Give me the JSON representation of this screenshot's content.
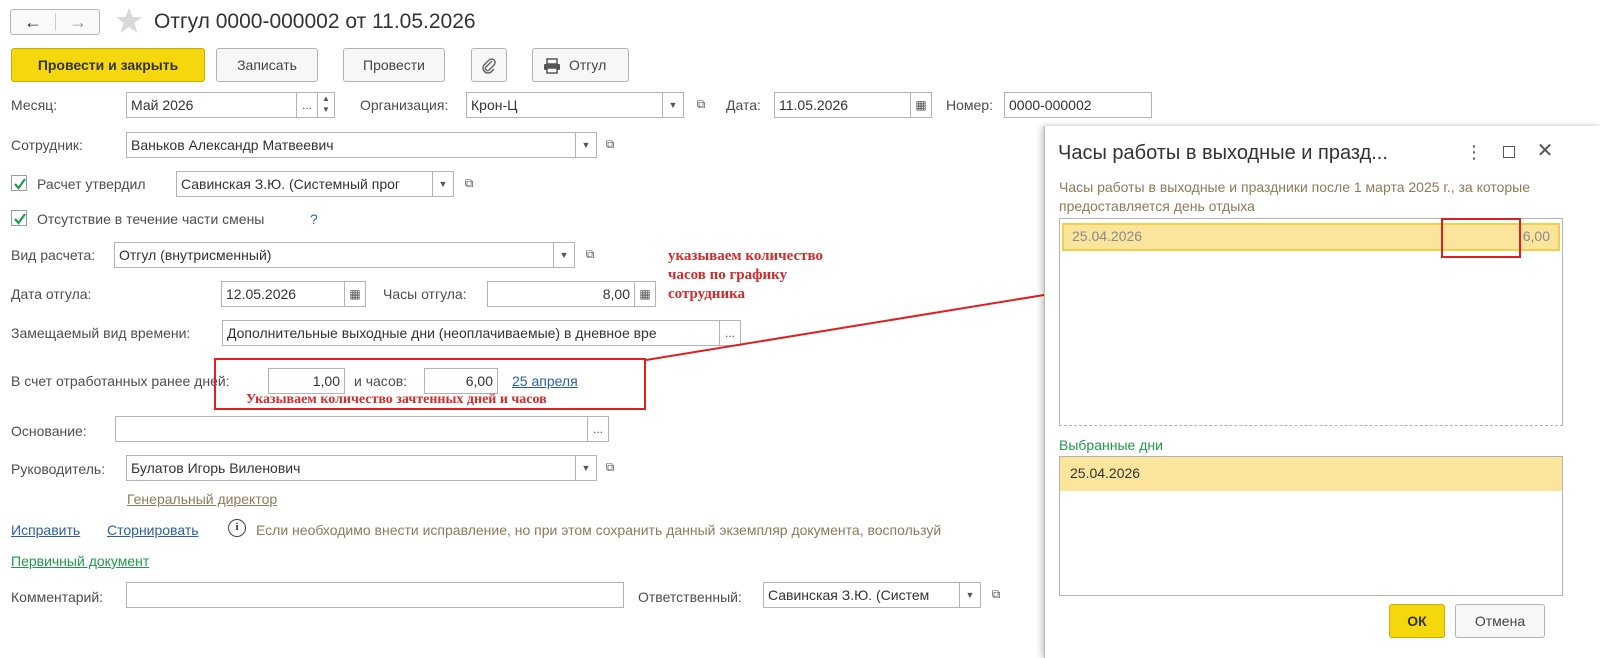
{
  "window": {
    "title": "Отгул 0000-000002 от 11.05.2026"
  },
  "toolbar": {
    "post_close": "Провести и закрыть",
    "save": "Записать",
    "post": "Провести",
    "print": "Отгул"
  },
  "form": {
    "month_label": "Месяц:",
    "month_value": "Май 2026",
    "org_label": "Организация:",
    "org_value": "Крон-Ц",
    "date_label": "Дата:",
    "date_value": "11.05.2026",
    "number_label": "Номер:",
    "number_value": "0000-000002",
    "employee_label": "Сотрудник:",
    "employee_value": "Ваньков Александр Матвеевич",
    "approved_label": "Расчет утвердил",
    "approved_value": "Савинская З.Ю. (Системный прог",
    "partial_label": "Отсутствие в течение части смены",
    "help": "?",
    "calc_type_label": "Вид расчета:",
    "calc_type_value": "Отгул (внутрисменный)",
    "leave_date_label": "Дата отгула:",
    "leave_date_value": "12.05.2026",
    "leave_hours_label": "Часы отгула:",
    "leave_hours_value": "8,00",
    "replaced_label": "Замещаемый вид времени:",
    "replaced_value": "Дополнительные выходные дни (неоплачиваемые) в дневное вре",
    "worked_label": "В счет отработанных ранее дней:",
    "worked_days_value": "1,00",
    "worked_hours_label": "и часов:",
    "worked_hours_value": "6,00",
    "worked_link": "25 апреля",
    "basis_label": "Основание:",
    "basis_value": "",
    "manager_label": "Руководитель:",
    "manager_value": "Булатов Игорь Виленович",
    "manager_position": "Генеральный директор",
    "fix_link": "Исправить",
    "storno_link": "Сторнировать",
    "info_text": "Если необходимо внести исправление, но при этом сохранить данный экземпляр документа, воспользуй",
    "primary_doc_link": "Первичный документ",
    "comment_label": "Комментарий:",
    "comment_value": "",
    "responsible_label": "Ответственный:",
    "responsible_value": "Савинская З.Ю. (Систем"
  },
  "annotations": {
    "hours_note_1": "указываем количество",
    "hours_note_2": "часов по графику",
    "hours_note_3": "сотрудника",
    "counted_note": "Указываем количество зачтенных дней и часов"
  },
  "dialog": {
    "title": "Часы работы в выходные и празд...",
    "description": "Часы работы в выходные и праздники после 1 марта 2025 г., за которые предоставляется день отдыха",
    "rows": [
      {
        "date": "25.04.2026",
        "hours": "6,00"
      }
    ],
    "selected_label": "Выбранные дни",
    "selected_rows": [
      "25.04.2026"
    ],
    "ok": "ОК",
    "cancel": "Отмена"
  },
  "colors": {
    "accent_yellow": "#f5d70d",
    "annotation_red": "#e02020",
    "link_blue": "#2a5ea8",
    "green_text": "#1f9a4a"
  }
}
